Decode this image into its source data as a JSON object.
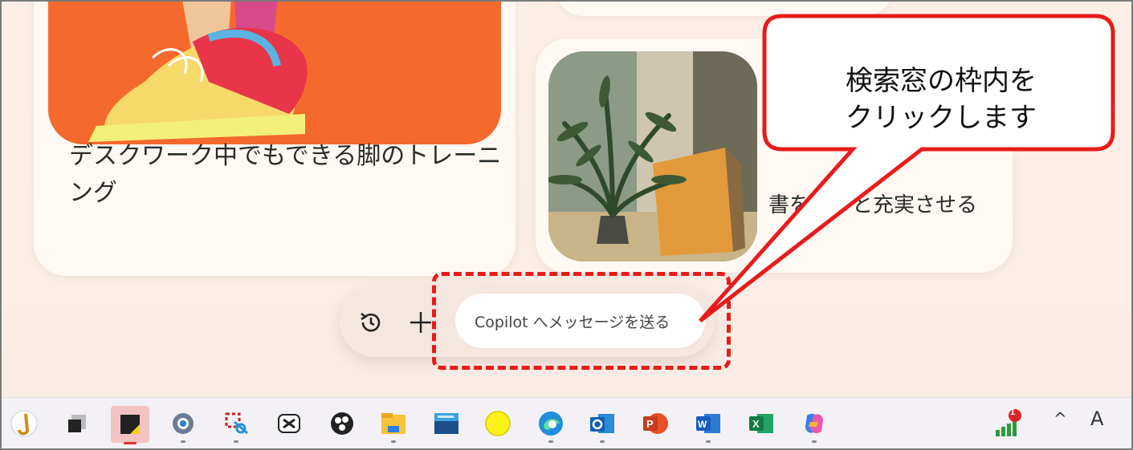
{
  "cards": {
    "left_title": "デスクワーク中でもできる脚のトレーニング",
    "right_title_partial": "書をもっと充実させる"
  },
  "composer": {
    "history_icon": "history-icon",
    "plus_icon": "plus-icon",
    "placeholder": "Copilot へメッセージを送る"
  },
  "callout": {
    "line1": "検索窓の枠内を",
    "line2": "クリックします",
    "color": "#e81b1b"
  },
  "taskbar": {
    "notification_count": "1",
    "tray_caret": "^",
    "ime_indicator": "A",
    "apps": [
      "saxophone-app-icon",
      "window-app-icon",
      "sticky-notes-icon",
      "settings-icon",
      "snipping-tool-icon",
      "capcut-icon",
      "obs-icon",
      "file-explorer-icon",
      "keyboard-app-icon",
      "yellow-circle-app-icon",
      "edge-icon",
      "outlook-icon",
      "powerpoint-icon",
      "word-icon",
      "excel-icon",
      "copilot-icon"
    ]
  }
}
